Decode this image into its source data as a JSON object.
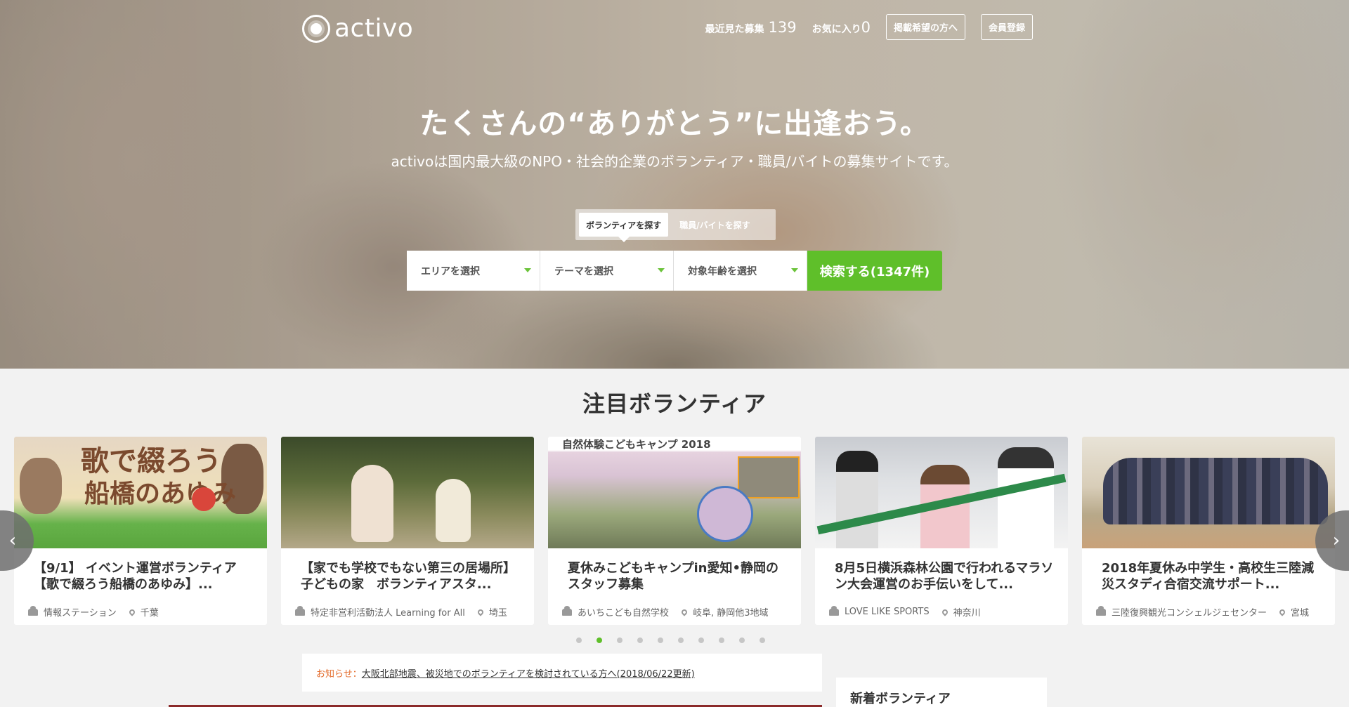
{
  "header": {
    "logo_text": "activo",
    "recent_label": "最近見た募集",
    "recent_count": "139",
    "favorites_label": "お気に入り",
    "favorites_count": "0",
    "publish_button": "掲載希望の方へ",
    "register_button": "会員登録"
  },
  "hero": {
    "headline": "たくさんの“ありがとう”に出逢おう。",
    "subline": "activoは国内最大級のNPO・社会的企業のボランティア・職員/バイトの募集サイトです。",
    "tabs": [
      {
        "label": "ボランティアを探す",
        "active": true
      },
      {
        "label": "職員/バイトを探す",
        "active": false
      }
    ],
    "search": {
      "area_placeholder": "エリアを選択",
      "theme_placeholder": "テーマを選択",
      "age_placeholder": "対象年齢を選択",
      "button_label": "検索する(1347件)"
    }
  },
  "featured": {
    "title": "注目ボランティア",
    "cards": [
      {
        "title": "【9/1】 イベント運営ボランティア【歌で綴ろう船橋のあゆみ】...",
        "org": "情報ステーション",
        "location": "千葉",
        "image_text_1": "歌で綴ろう",
        "image_text_2": "船橋のあゆみ"
      },
      {
        "title": "【家でも学校でもない第三の居場所】子どもの家　ボランティアスタ...",
        "org": "特定非営利活動法人 Learning for All",
        "location": "埼玉"
      },
      {
        "title": "夏休みこどもキャンプin愛知•静岡のスタッフ募集",
        "org": "あいちこども自然学校",
        "location": "岐阜, 静岡他3地域",
        "image_text_1": "自然体験こどもキャンプ 2018"
      },
      {
        "title": "8月5日横浜森林公園で行われるマラソン大会運営のお手伝いをして...",
        "org": "LOVE LIKE SPORTS",
        "location": "神奈川"
      },
      {
        "title": "2018年夏休み中学生・高校生三陸減災スタディ合宿交流サポート...",
        "org": "三陸復興観光コンシェルジェセンター",
        "location": "宮城"
      }
    ],
    "prev_arrow": "‹",
    "next_arrow": "›",
    "dots_count": 10,
    "active_dot": 1
  },
  "notice": {
    "label": "お知らせ",
    "separator": "：",
    "link_text": "大阪北部地震、被災地でのボランティアを検討されている方へ(2018/06/22更新)"
  },
  "sidebar": {
    "new_title": "新着ボランティア"
  },
  "colors": {
    "accent": "#5fbf2a",
    "notice_label": "#e36b2b"
  }
}
